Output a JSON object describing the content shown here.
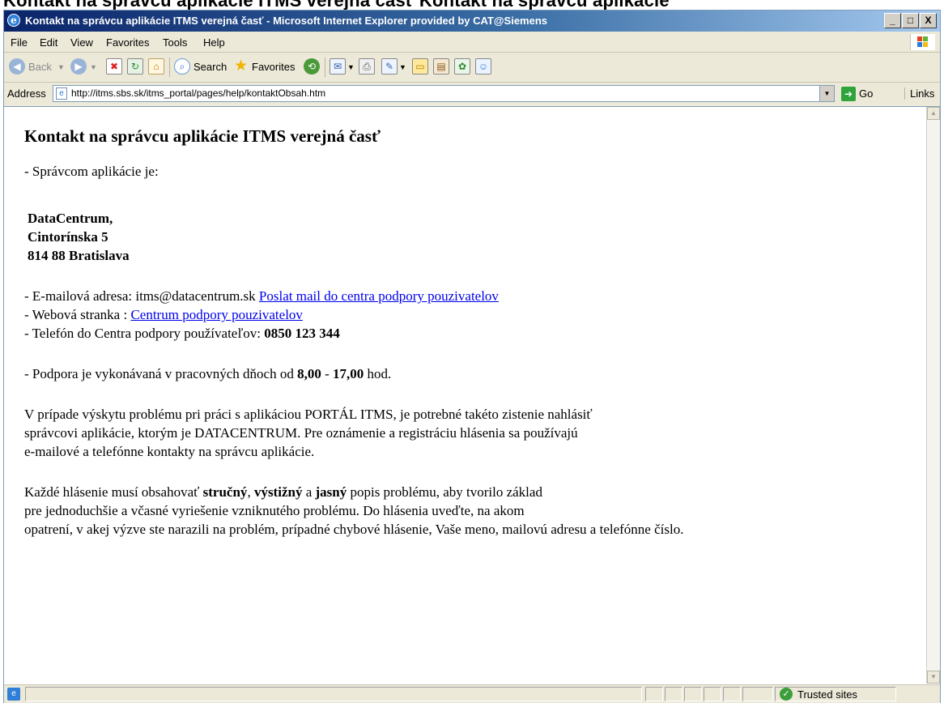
{
  "banner": {
    "cropped_text": "Kontakt na správcu aplikácie ITMS verejná časť Kontakt na správcu aplikácie"
  },
  "window": {
    "title": "Kontakt na správcu aplikácie ITMS verejná časť - Microsoft Internet Explorer provided by CAT@Siemens",
    "minimize": "_",
    "maximize": "□",
    "close": "X"
  },
  "menu": {
    "items": [
      "File",
      "Edit",
      "View",
      "Favorites",
      "Tools",
      "Help"
    ]
  },
  "toolbar": {
    "back_label": "Back",
    "search_label": "Search",
    "favorites_label": "Favorites"
  },
  "address_bar": {
    "label": "Address",
    "url": "http://itms.sbs.sk/itms_portal/pages/help/kontaktObsah.htm",
    "go_label": "Go",
    "links_label": "Links"
  },
  "page": {
    "heading": "Kontakt na správcu aplikácie ITMS verejná časť",
    "administrator_intro": "- Správcom aplikácie je:",
    "address_lines": [
      "DataCentrum,",
      "Cintorínska 5",
      "814 88 Bratislava"
    ],
    "email": {
      "prefix": "- E-mailová adresa: itms@datacentrum.sk ",
      "link_text": "Poslat mail do centra podpory pouzivatelov"
    },
    "web": {
      "prefix": "- Webová stranka : ",
      "link_text": "Centrum podpory pouzivatelov"
    },
    "phone": {
      "prefix": "- Telefón do Centra podpory používateľov: ",
      "number": "0850 123 344"
    },
    "hours": {
      "prefix": "- Podpora je vykonávaná v pracovných dňoch od ",
      "start": "8,00",
      "dash": " - ",
      "end": "17,00",
      "suffix": " hod."
    },
    "paragraph1": [
      "V prípade výskytu problému pri práci s aplikáciou PORTÁL ITMS, je potrebné takéto zistenie nahlásiť",
      "správcovi aplikácie, ktorým je DATACENTRUM. Pre oznámenie a registráciu hlásenia sa používajú",
      "e-mailové a telefónne kontakty na správcu aplikácie."
    ],
    "paragraph2": {
      "line1_prefix": "Každé hlásenie musí obsahovať ",
      "bold1": "stručný",
      "sep1": ", ",
      "bold2": "výstižný",
      "sep2": " a ",
      "bold3": "jasný",
      "line1_suffix": " popis problému, aby tvorilo základ",
      "line2": "pre jednoduchšie a včasné vyriešenie vzniknutého problému. Do hlásenia uveďte, na akom",
      "line3": "opatrení, v akej výzve ste narazili na problém, prípadné chybové hlásenie, Vaše meno, mailovú adresu a telefónne číslo."
    }
  },
  "status_bar": {
    "zone_text": "Trusted sites"
  },
  "icons": {
    "window": "ie-logo-icon",
    "back": "back-arrow-icon",
    "forward": "forward-arrow-icon",
    "stop": "stop-icon",
    "refresh": "refresh-icon",
    "home": "home-icon",
    "search": "search-magnifier-icon",
    "favorites": "favorites-star-icon",
    "history": "history-icon",
    "mail": "mail-icon",
    "print": "print-icon",
    "edit": "edit-icon",
    "discuss": "discuss-icon",
    "research": "research-icon",
    "messenger": "messenger-icon",
    "page": "page-icon",
    "go": "go-arrow-icon",
    "trusted_zone": "trusted-zone-check-icon"
  },
  "colors": {
    "titlebar": "#0a246a",
    "link": "#0000ee",
    "chrome": "#ece9d8"
  }
}
